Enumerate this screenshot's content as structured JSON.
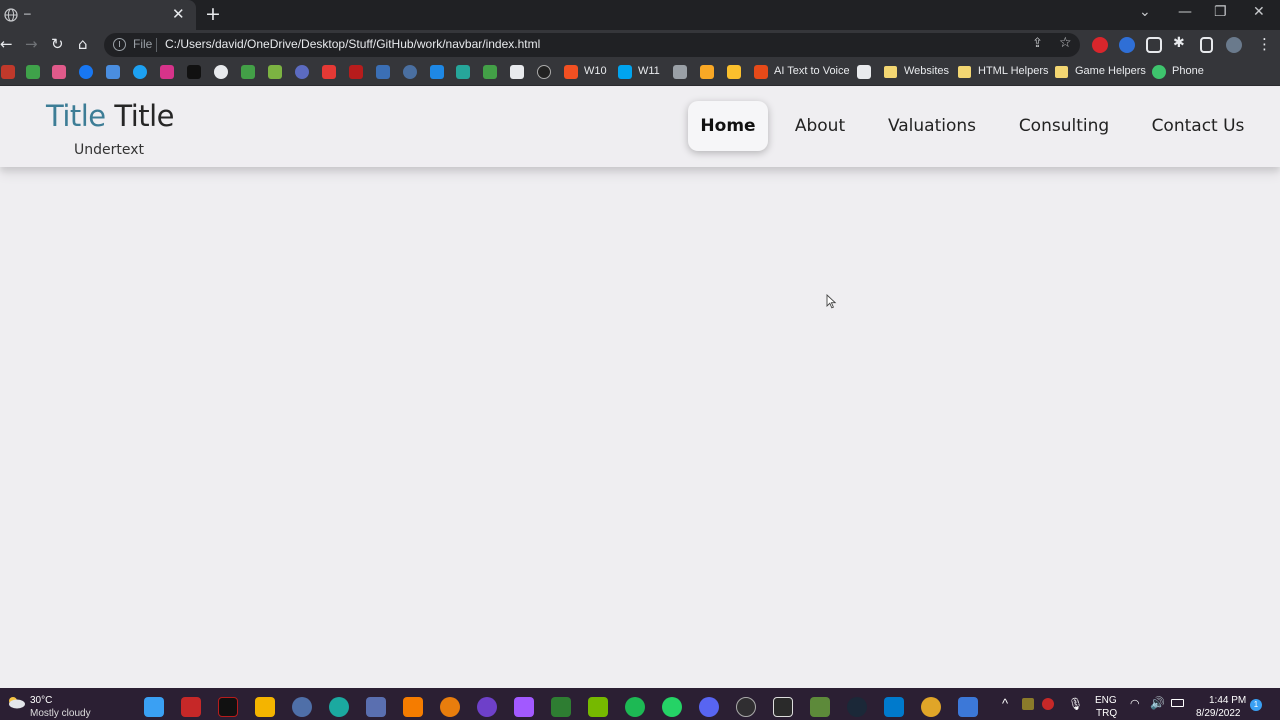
{
  "browser": {
    "tab_title": "–",
    "url_scheme": "File",
    "url": "C:/Users/david/OneDrive/Desktop/Stuff/GitHub/work/navbar/index.html",
    "bookmarks": {
      "w10": "W10",
      "w11": "W11",
      "ai_text": "AI Text to Voice",
      "websites": "Websites",
      "html_helpers": "HTML Helpers",
      "game_helpers": "Game Helpers",
      "phone": "Phone"
    }
  },
  "site": {
    "brand_accent": "Title",
    "brand_rest": "Title",
    "subtitle": "Undertext",
    "nav": [
      {
        "label": "Home",
        "active": true
      },
      {
        "label": "About"
      },
      {
        "label": "Valuations"
      },
      {
        "label": "Consulting"
      },
      {
        "label": "Contact Us"
      }
    ],
    "accent_color": "#3d7d96"
  },
  "taskbar": {
    "temperature": "30°C",
    "condition": "Mostly cloudy",
    "lang_top": "ENG",
    "lang_bottom": "TRQ",
    "time": "1:44 PM",
    "date": "8/29/2022",
    "notif_count": "1"
  }
}
